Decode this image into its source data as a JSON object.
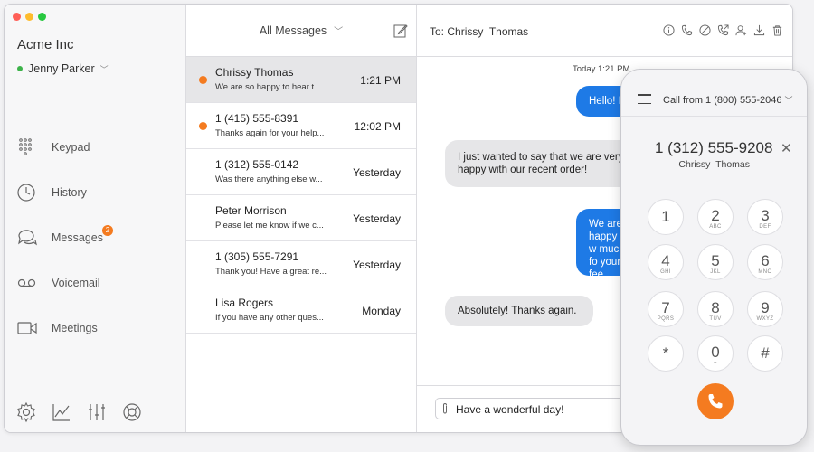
{
  "colors": {
    "accent": "#f47b20",
    "blue_bubble": "#1e7ae6",
    "presence": "#3db34a"
  },
  "sidebar": {
    "org_name": "Acme Inc",
    "user_name": "Jenny Parker",
    "nav": [
      {
        "label": "Keypad",
        "icon": "keypad-icon"
      },
      {
        "label": "History",
        "icon": "clock-icon"
      },
      {
        "label": "Messages",
        "icon": "chat-icon"
      },
      {
        "label": "Voicemail",
        "icon": "voicemail-icon"
      },
      {
        "label": "Meetings",
        "icon": "video-icon"
      }
    ],
    "messages_badge": "2",
    "tools": [
      "settings-icon",
      "analytics-icon",
      "equalizer-icon",
      "help-icon"
    ]
  },
  "list": {
    "filter_label": "All Messages",
    "rows": [
      {
        "name": "Chrissy Thomas",
        "preview": "We are so happy to hear t...",
        "time": "1:21 PM",
        "unread": true,
        "selected": true
      },
      {
        "name": "1 (415) 555-8391",
        "preview": "Thanks again for your help...",
        "time": "12:02 PM",
        "unread": true,
        "selected": false
      },
      {
        "name": "1 (312) 555-0142",
        "preview": "Was there anything else w...",
        "time": "Yesterday",
        "unread": false,
        "selected": false
      },
      {
        "name": "Peter Morrison",
        "preview": "Please let me know if we c...",
        "time": "Yesterday",
        "unread": false,
        "selected": false
      },
      {
        "name": "1 (305) 555-7291",
        "preview": "Thank you! Have a great re...",
        "time": "Yesterday",
        "unread": false,
        "selected": false
      },
      {
        "name": "Lisa Rogers",
        "preview": "If you have any other ques...",
        "time": "Monday",
        "unread": false,
        "selected": false
      }
    ]
  },
  "conversation": {
    "to_label": "To:",
    "to_name": "Chrissy  Thomas",
    "timestamp": "Today 1:21 PM",
    "bubbles": [
      {
        "dir": "out",
        "text": "Hello! I"
      },
      {
        "dir": "in",
        "text": "I just wanted to say that we are very happy with our recent order!"
      },
      {
        "dir": "out",
        "text": "We are happy w much fo your fee"
      },
      {
        "dir": "in",
        "text": "Absolutely! Thanks again."
      }
    ],
    "draft": "Have a wonderful day!",
    "header_icons": [
      "info-icon",
      "phone-icon",
      "block-icon",
      "call-forward-icon",
      "add-contact-icon",
      "download-icon",
      "trash-icon"
    ]
  },
  "phone": {
    "call_from": "Call from 1 (800) 555-2046",
    "dialed_number": "1 (312) 555-9208",
    "contact_name": "Chrissy  Thomas",
    "keys": [
      {
        "digit": "1",
        "letters": ""
      },
      {
        "digit": "2",
        "letters": "ABC"
      },
      {
        "digit": "3",
        "letters": "DEF"
      },
      {
        "digit": "4",
        "letters": "GHI"
      },
      {
        "digit": "5",
        "letters": "JKL"
      },
      {
        "digit": "6",
        "letters": "MNO"
      },
      {
        "digit": "7",
        "letters": "PQRS"
      },
      {
        "digit": "8",
        "letters": "TUV"
      },
      {
        "digit": "9",
        "letters": "WXYZ"
      },
      {
        "digit": "*",
        "letters": ""
      },
      {
        "digit": "0",
        "letters": "+"
      },
      {
        "digit": "#",
        "letters": ""
      }
    ]
  }
}
